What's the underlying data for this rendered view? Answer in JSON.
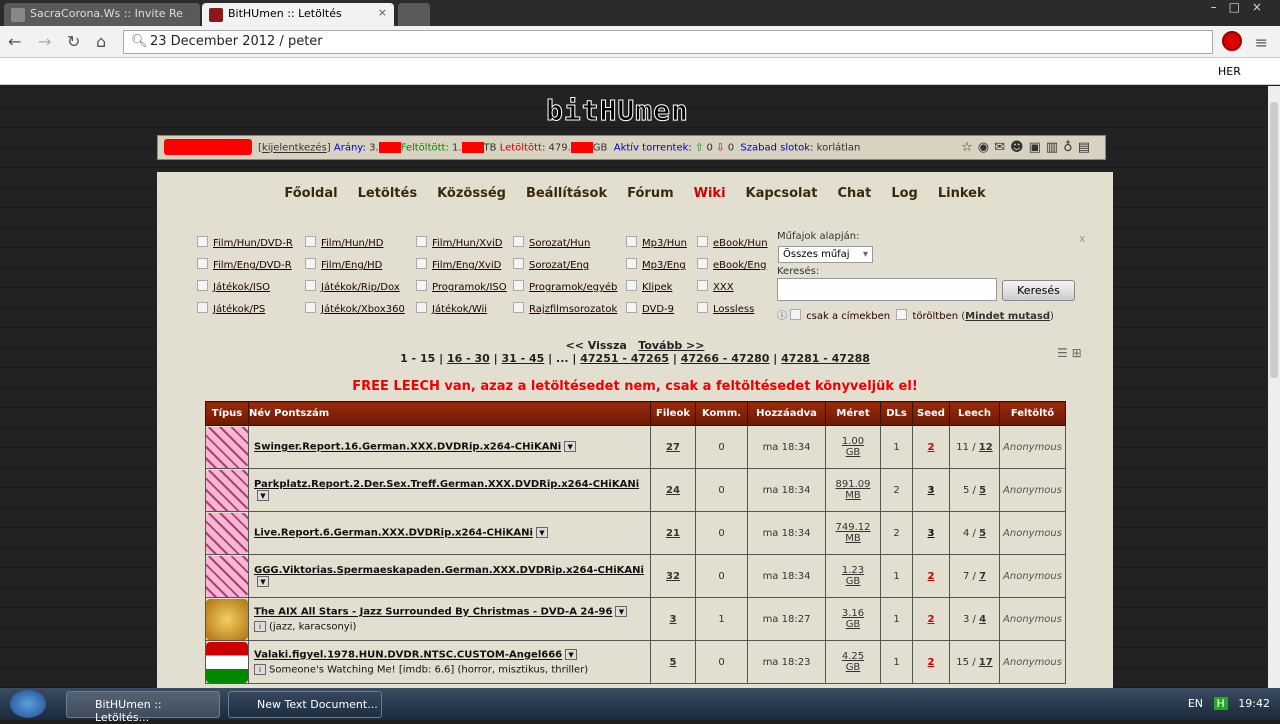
{
  "browser": {
    "tabs": [
      {
        "label": "SacraCorona.Ws :: Invite Re"
      },
      {
        "label": "BitHUmen :: Letöltés"
      }
    ],
    "address": "23 December 2012 / peter",
    "bookmark": "HER"
  },
  "site": {
    "logo": "bitHUmen",
    "userbar": {
      "logout": "kijelentkezés",
      "ratio_label": "Arány:",
      "ratio": "3.",
      "up_label": "Feltöltött:",
      "up": "1.",
      "up_unit": "TB",
      "down_label": "Letöltött:",
      "down": "479.",
      "down_unit": "GB",
      "active_label": "Aktív torrentek:",
      "up_count": "0",
      "down_count": "0",
      "slots_label": "Szabad slotok:",
      "slots": "korlátlan"
    },
    "nav": [
      "Főoldal",
      "Letöltés",
      "Közösség",
      "Beállítások",
      "Fórum",
      "Wiki",
      "Kapcsolat",
      "Chat",
      "Log",
      "Linkek"
    ],
    "categories": [
      [
        "Film/Hun/DVD-R",
        "Film/Eng/DVD-R",
        "Játékok/ISO",
        "Játékok/PS"
      ],
      [
        "Film/Hun/HD",
        "Film/Eng/HD",
        "Játékok/Rip/Dox",
        "Játékok/Xbox360"
      ],
      [
        "Film/Hun/XviD",
        "Film/Eng/XviD",
        "Programok/ISO",
        "Játékok/Wii"
      ],
      [
        "Sorozat/Hun",
        "Sorozat/Eng",
        "Programok/egyéb",
        "Rajzfilmsorozatok"
      ],
      [
        "Mp3/Hun",
        "Mp3/Eng",
        "Klipek",
        "DVD-9"
      ],
      [
        "eBook/Hun",
        "eBook/Eng",
        "XXX",
        "Lossless"
      ]
    ],
    "search": {
      "genre_label": "Műfajok alapján:",
      "genre_value": "Összes műfaj",
      "search_label": "Keresés:",
      "search_value": "",
      "button": "Keresés",
      "only_titles": "csak a címekben",
      "deleted": "töröltben",
      "show_all": "Mindet mutasd",
      "close": "x"
    },
    "pager": {
      "prev": "<< Vissza",
      "next": "Tovább >>",
      "current": "1 - 15",
      "pages": [
        "16 - 30",
        "31 - 45",
        "...",
        "47251 - 47265",
        "47266 - 47280",
        "47281 - 47288"
      ]
    },
    "notice": "FREE LEECH van, azaz a letöltésedet nem, csak a feltöltésedet könyveljük el!",
    "table": {
      "headers": [
        "Típus",
        "Név Pontszám",
        "Fileok",
        "Komm.",
        "Hozzáadva",
        "Méret",
        "DLs",
        "Seed",
        "Leech",
        "Feltöltő"
      ],
      "rows": [
        {
          "type": "xxx",
          "name": "Swinger.Report.16.German.XXX.DVDRip.x264-CHiKANi",
          "sub": "",
          "files": "27",
          "comm": "0",
          "added": "ma 18:34",
          "size": "1.00",
          "unit": "GB",
          "dls": "1",
          "seed": "2",
          "leech_a": "11",
          "leech_b": "12",
          "uploader": "Anonymous"
        },
        {
          "type": "xxx",
          "name": "Parkplatz.Report.2.Der.Sex.Treff.German.XXX.DVDRip.x264-CHiKANi",
          "sub": "",
          "files": "24",
          "comm": "0",
          "added": "ma 18:34",
          "size": "891.09",
          "unit": "MB",
          "dls": "2",
          "seed": "3",
          "leech_a": "5",
          "leech_b": "5",
          "uploader": "Anonymous"
        },
        {
          "type": "xxx",
          "name": "Live.Report.6.German.XXX.DVDRip.x264-CHiKANi",
          "sub": "",
          "files": "21",
          "comm": "0",
          "added": "ma 18:34",
          "size": "749.12",
          "unit": "MB",
          "dls": "2",
          "seed": "3",
          "leech_a": "4",
          "leech_b": "5",
          "uploader": "Anonymous"
        },
        {
          "type": "xxx",
          "name": "GGG.Viktorias.Spermaeskapaden.German.XXX.DVDRip.x264-CHiKANi",
          "sub": "",
          "files": "32",
          "comm": "0",
          "added": "ma 18:34",
          "size": "1.23",
          "unit": "GB",
          "dls": "1",
          "seed": "2",
          "leech_a": "7",
          "leech_b": "7",
          "uploader": "Anonymous"
        },
        {
          "type": "lossless",
          "name": "The AIX All Stars - Jazz Surrounded By Christmas - DVD-A 24-96",
          "sub": "(jazz, karacsonyi)",
          "files": "3",
          "comm": "1",
          "added": "ma 18:27",
          "size": "3.16",
          "unit": "GB",
          "dls": "1",
          "seed": "2",
          "leech_a": "3",
          "leech_b": "4",
          "uploader": "Anonymous"
        },
        {
          "type": "dvd-hun",
          "name": "Valaki.figyel.1978.HUN.DVDR.NTSC.CUSTOM-Angel666",
          "sub": "Someone's Watching Me! [imdb: 6.6] (horror, misztikus, thriller)",
          "files": "5",
          "comm": "0",
          "added": "ma 18:23",
          "size": "4.25",
          "unit": "GB",
          "dls": "1",
          "seed": "2",
          "leech_a": "15",
          "leech_b": "17",
          "uploader": "Anonymous"
        }
      ]
    }
  },
  "taskbar": {
    "items": [
      "BitHUmen :: Letöltés...",
      "New Text Document..."
    ],
    "lang": "EN",
    "time": "19:42"
  },
  "colors": {
    "header": "#7a1f08",
    "notice": "#e00000",
    "seed_low": "#cc0000"
  }
}
